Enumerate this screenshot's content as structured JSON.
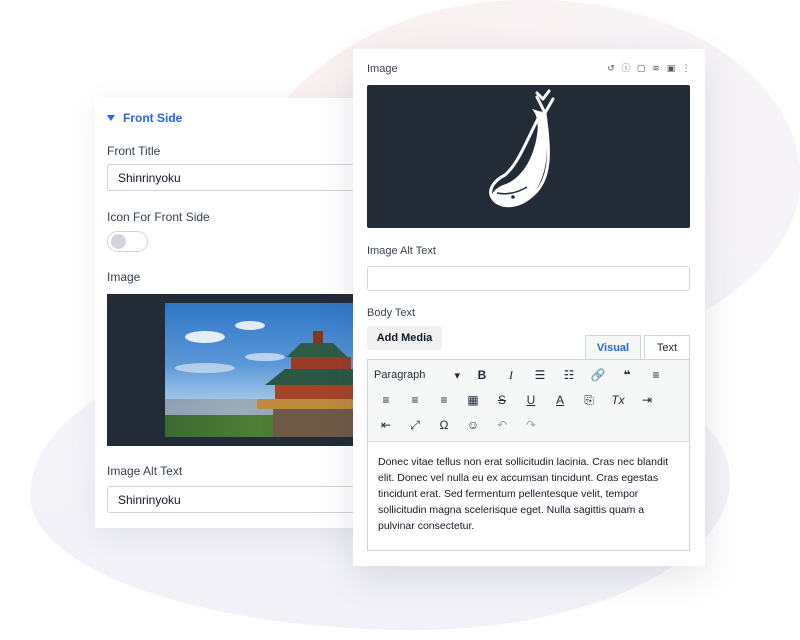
{
  "back_panel": {
    "section_title": "Front Side",
    "front_title_label": "Front Title",
    "front_title_value": "Shinrinyoku",
    "icon_toggle_label": "Icon For Front Side",
    "icon_toggle_on": false,
    "image_label": "Image",
    "image_alt_label": "Image Alt Text",
    "image_alt_value": "Shinrinyoku"
  },
  "front_panel": {
    "image_label": "Image",
    "tool_icons": [
      "undo-icon",
      "info-icon",
      "clipboard-icon",
      "database-icon",
      "ai-icon",
      "more-vertical-icon"
    ],
    "image_alt_label": "Image Alt Text",
    "image_alt_value": "",
    "body_text_label": "Body Text",
    "add_media_label": "Add Media",
    "tabs": [
      {
        "label": "Visual",
        "active": true
      },
      {
        "label": "Text",
        "active": false
      }
    ],
    "format_select": "Paragraph",
    "toolbar_row1": [
      "B",
      "I",
      "☰",
      "☷",
      "🔗",
      "❝",
      "≡"
    ],
    "toolbar_row2": [
      "≡",
      "≡",
      "≡",
      "▦",
      "S",
      "U",
      "A",
      "⎘",
      "Tx",
      "⇥"
    ],
    "toolbar_row3": [
      "⇤",
      "⤢",
      "Ω",
      "☺",
      "↶",
      "↷"
    ],
    "body_text": "Donec vitae tellus non erat sollicitudin lacinia. Cras nec blandit elit. Donec vel nulla eu ex accumsan tincidunt. Cras egestas tincidunt erat. Sed fermentum pellentesque velit, tempor sollicitudin magna scelerisque eget. Nulla sagittis quam a pulvinar consectetur."
  },
  "colors": {
    "accent": "#2563eb",
    "image_bg": "#222b36"
  }
}
